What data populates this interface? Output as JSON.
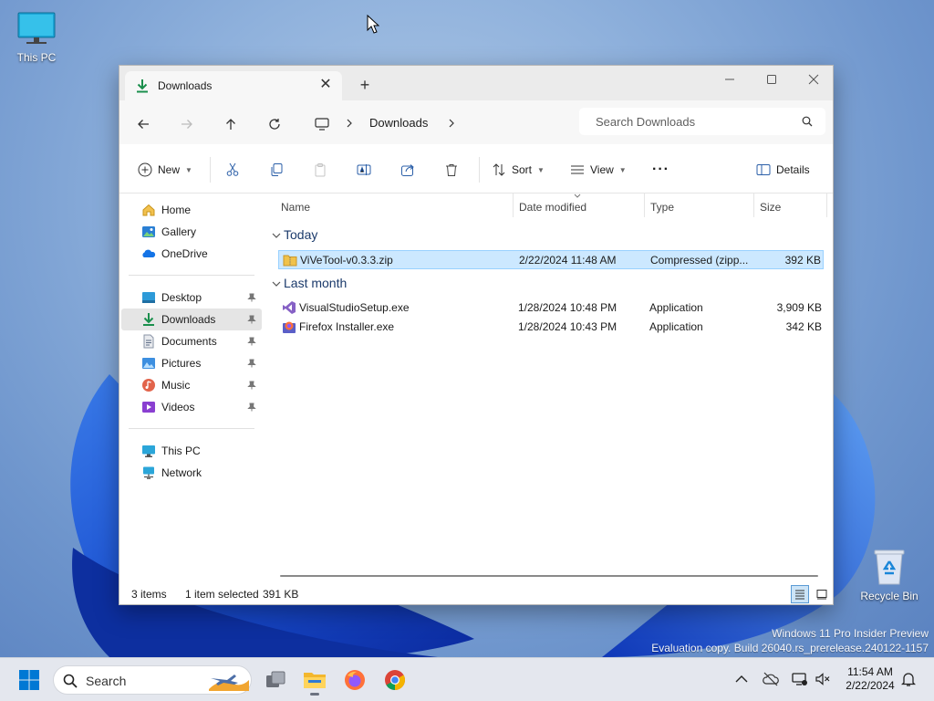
{
  "desktop": {
    "this_pc_label": "This PC",
    "recycle_bin_label": "Recycle Bin",
    "watermark_line1": "Windows 11 Pro Insider Preview",
    "watermark_line2": "Evaluation copy. Build 26040.rs_prerelease.240122-1157"
  },
  "window": {
    "tab_title": "Downloads",
    "tab_close": "✕",
    "new_tab": "+",
    "breadcrumb": [
      "Downloads"
    ],
    "search_placeholder": "Search Downloads"
  },
  "commands": {
    "new_label": "New",
    "sort_label": "Sort",
    "view_label": "View",
    "more_label": "···",
    "details_label": "Details"
  },
  "nav": {
    "quick": [
      {
        "label": "Home",
        "icon": "home-icon"
      },
      {
        "label": "Gallery",
        "icon": "gallery-icon"
      },
      {
        "label": "OneDrive",
        "icon": "onedrive-icon"
      }
    ],
    "pinned": [
      {
        "label": "Desktop",
        "icon": "desktop-folder-icon"
      },
      {
        "label": "Downloads",
        "icon": "downloads-icon",
        "selected": true
      },
      {
        "label": "Documents",
        "icon": "documents-icon"
      },
      {
        "label": "Pictures",
        "icon": "pictures-icon"
      },
      {
        "label": "Music",
        "icon": "music-icon"
      },
      {
        "label": "Videos",
        "icon": "videos-icon"
      }
    ],
    "devices": [
      {
        "label": "This PC",
        "icon": "this-pc-icon"
      },
      {
        "label": "Network",
        "icon": "network-icon"
      }
    ]
  },
  "columns": {
    "name": "Name",
    "date": "Date modified",
    "type": "Type",
    "size": "Size"
  },
  "groups": [
    {
      "label": "Today",
      "files": [
        {
          "name": "ViVeTool-v0.3.3.zip",
          "date": "2/22/2024 11:48 AM",
          "type": "Compressed (zipp...",
          "size": "392 KB",
          "icon": "zip-folder-icon",
          "selected": true
        }
      ]
    },
    {
      "label": "Last month",
      "files": [
        {
          "name": "VisualStudioSetup.exe",
          "date": "1/28/2024 10:48 PM",
          "type": "Application",
          "size": "3,909 KB",
          "icon": "visual-studio-icon"
        },
        {
          "name": "Firefox Installer.exe",
          "date": "1/28/2024 10:43 PM",
          "type": "Application",
          "size": "342 KB",
          "icon": "firefox-installer-icon"
        }
      ]
    }
  ],
  "status": {
    "items": "3 items",
    "selected": "1 item selected",
    "size": "391 KB"
  },
  "taskbar": {
    "search_placeholder": "Search",
    "time": "11:54 AM",
    "date": "2/22/2024"
  },
  "colors": {
    "accent": "#0067c0",
    "selection": "#cce8ff",
    "downloads_green": "#1a8f4c"
  }
}
